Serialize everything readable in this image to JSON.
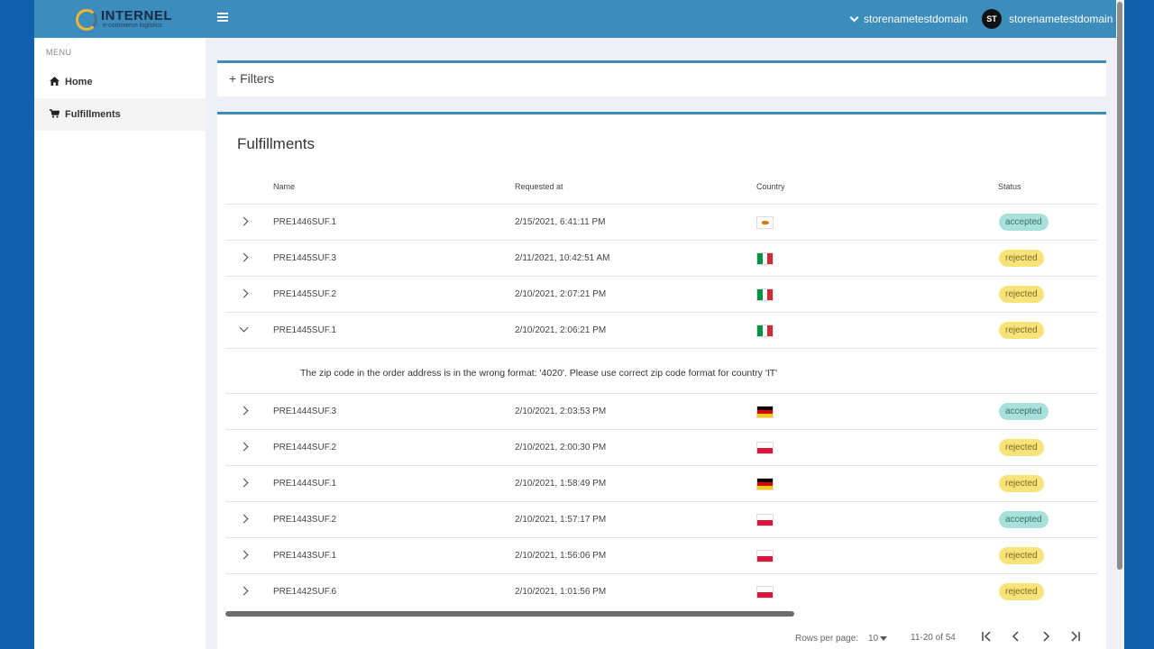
{
  "header": {
    "logo_text": "INTERNEL",
    "logo_sub": "e-commerce logistics",
    "store_dropdown": "storenametestdomain",
    "avatar_initials": "ST",
    "user_name": "storenametestdomain"
  },
  "sidebar": {
    "menu_label": "MENU",
    "items": [
      {
        "label": "Home",
        "icon": "home-icon"
      },
      {
        "label": "Fulfillments",
        "icon": "cart-icon"
      }
    ]
  },
  "filters": {
    "label": "+ Filters"
  },
  "fulfillments": {
    "title": "Fulfillments",
    "columns": [
      "Name",
      "Requested at",
      "Country",
      "Status"
    ],
    "rows": [
      {
        "name": "PRE1446SUF.1",
        "requested_at": "2/15/2021, 6:41:11 PM",
        "country": "CY",
        "status": "accepted"
      },
      {
        "name": "PRE1445SUF.3",
        "requested_at": "2/11/2021, 10:42:51 AM",
        "country": "IT",
        "status": "rejected"
      },
      {
        "name": "PRE1445SUF.2",
        "requested_at": "2/10/2021, 2:07:21 PM",
        "country": "IT",
        "status": "rejected"
      },
      {
        "name": "PRE1445SUF.1",
        "requested_at": "2/10/2021, 2:06:21 PM",
        "country": "IT",
        "status": "rejected"
      },
      {
        "name": "PRE1444SUF.3",
        "requested_at": "2/10/2021, 2:03:53 PM",
        "country": "DE",
        "status": "accepted"
      },
      {
        "name": "PRE1444SUF.2",
        "requested_at": "2/10/2021, 2:00:30 PM",
        "country": "PL",
        "status": "rejected"
      },
      {
        "name": "PRE1444SUF.1",
        "requested_at": "2/10/2021, 1:58:49 PM",
        "country": "DE",
        "status": "rejected"
      },
      {
        "name": "PRE1443SUF.2",
        "requested_at": "2/10/2021, 1:57:17 PM",
        "country": "PL",
        "status": "accepted"
      },
      {
        "name": "PRE1443SUF.1",
        "requested_at": "2/10/2021, 1:56:06 PM",
        "country": "PL",
        "status": "rejected"
      },
      {
        "name": "PRE1442SUF.6",
        "requested_at": "2/10/2021, 1:01:56 PM",
        "country": "PL",
        "status": "rejected"
      }
    ],
    "expanded_message": "The zip code in the order address is in the wrong format: '4020'. Please use correct zip code format for country 'IT'"
  },
  "pagination": {
    "rows_per_page_label": "Rows per page:",
    "rows_per_page_value": "10",
    "range": "11-20 of 54"
  },
  "colors": {
    "accent": "#3c8dbc",
    "accepted_badge": "#a8e0dc",
    "rejected_badge": "#f8e37a"
  }
}
